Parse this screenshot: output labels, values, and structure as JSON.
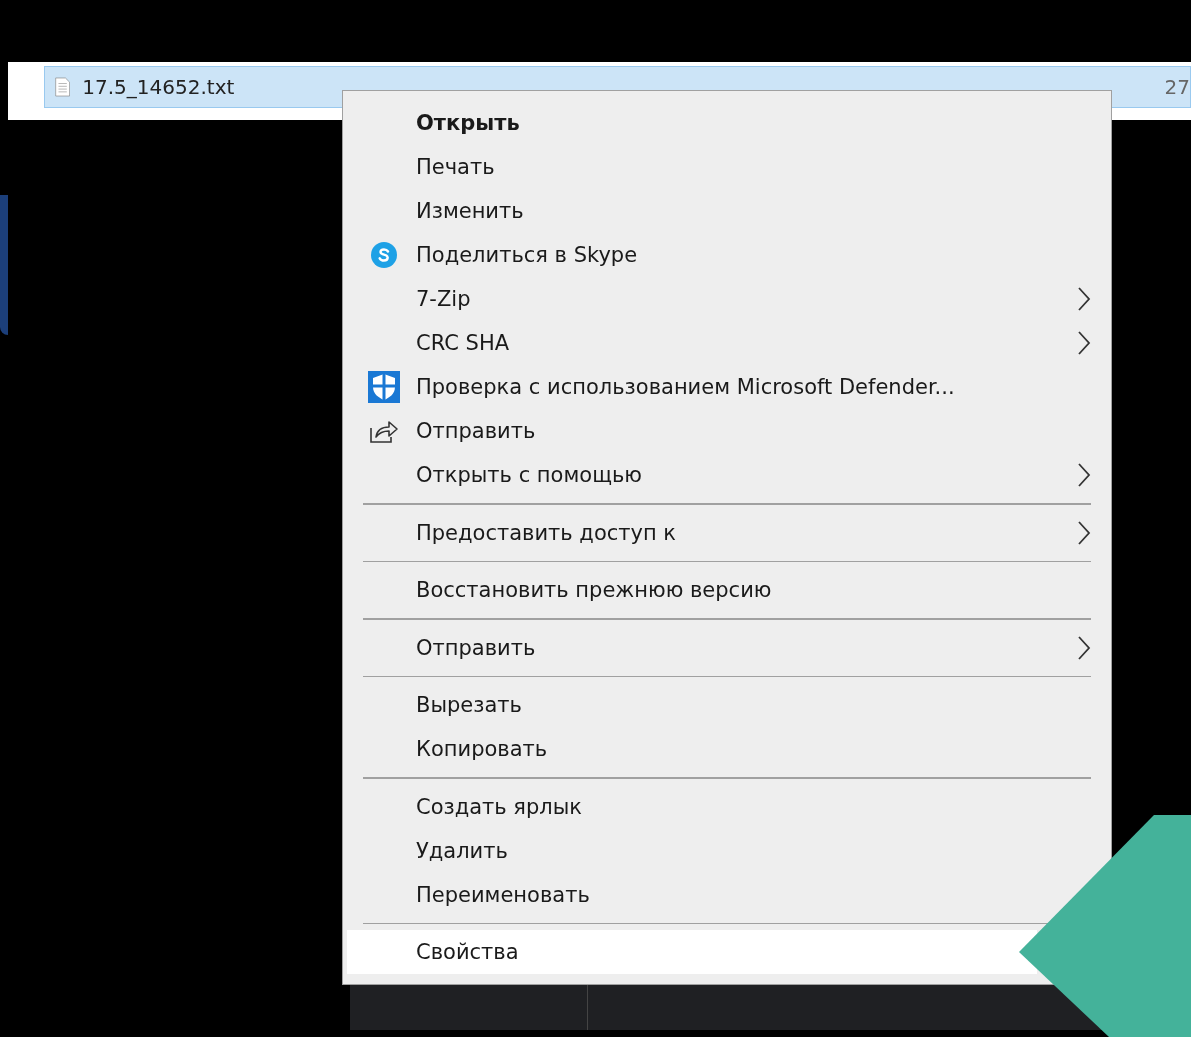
{
  "file_row": {
    "name": "17.5_14652.txt",
    "size": "27",
    "selected": true
  },
  "context_menu": [
    {
      "kind": "plain",
      "label": "Открыть",
      "default": true,
      "submenu": false,
      "selected": false
    },
    {
      "kind": "plain",
      "label": "Печать",
      "default": false,
      "submenu": false,
      "selected": false
    },
    {
      "kind": "plain",
      "label": "Изменить",
      "default": false,
      "submenu": false,
      "selected": false
    },
    {
      "kind": "skype",
      "label": "Поделиться в Skype",
      "default": false,
      "submenu": false,
      "selected": false
    },
    {
      "kind": "plain",
      "label": "7-Zip",
      "default": false,
      "submenu": true,
      "selected": false
    },
    {
      "kind": "plain",
      "label": "CRC SHA",
      "default": false,
      "submenu": true,
      "selected": false
    },
    {
      "kind": "shield",
      "label": "Проверка с использованием Microsoft Defender...",
      "default": false,
      "submenu": false,
      "selected": false
    },
    {
      "kind": "share",
      "label": "Отправить",
      "default": false,
      "submenu": false,
      "selected": false
    },
    {
      "kind": "plain",
      "label": "Открыть с помощью",
      "default": false,
      "submenu": true,
      "selected": false
    },
    {
      "kind": "separator"
    },
    {
      "kind": "plain",
      "label": "Предоставить доступ к",
      "default": false,
      "submenu": true,
      "selected": false
    },
    {
      "kind": "separator"
    },
    {
      "kind": "plain",
      "label": "Восстановить прежнюю версию",
      "default": false,
      "submenu": false,
      "selected": false
    },
    {
      "kind": "separator"
    },
    {
      "kind": "plain",
      "label": "Отправить",
      "default": false,
      "submenu": true,
      "selected": false
    },
    {
      "kind": "separator"
    },
    {
      "kind": "plain",
      "label": "Вырезать",
      "default": false,
      "submenu": false,
      "selected": false
    },
    {
      "kind": "plain",
      "label": "Копировать",
      "default": false,
      "submenu": false,
      "selected": false
    },
    {
      "kind": "separator"
    },
    {
      "kind": "plain",
      "label": "Создать ярлык",
      "default": false,
      "submenu": false,
      "selected": false
    },
    {
      "kind": "plain",
      "label": "Удалить",
      "default": false,
      "submenu": false,
      "selected": false
    },
    {
      "kind": "plain",
      "label": "Переименовать",
      "default": false,
      "submenu": false,
      "selected": false
    },
    {
      "kind": "separator"
    },
    {
      "kind": "plain",
      "label": "Свойства",
      "default": false,
      "submenu": false,
      "selected": true
    }
  ]
}
